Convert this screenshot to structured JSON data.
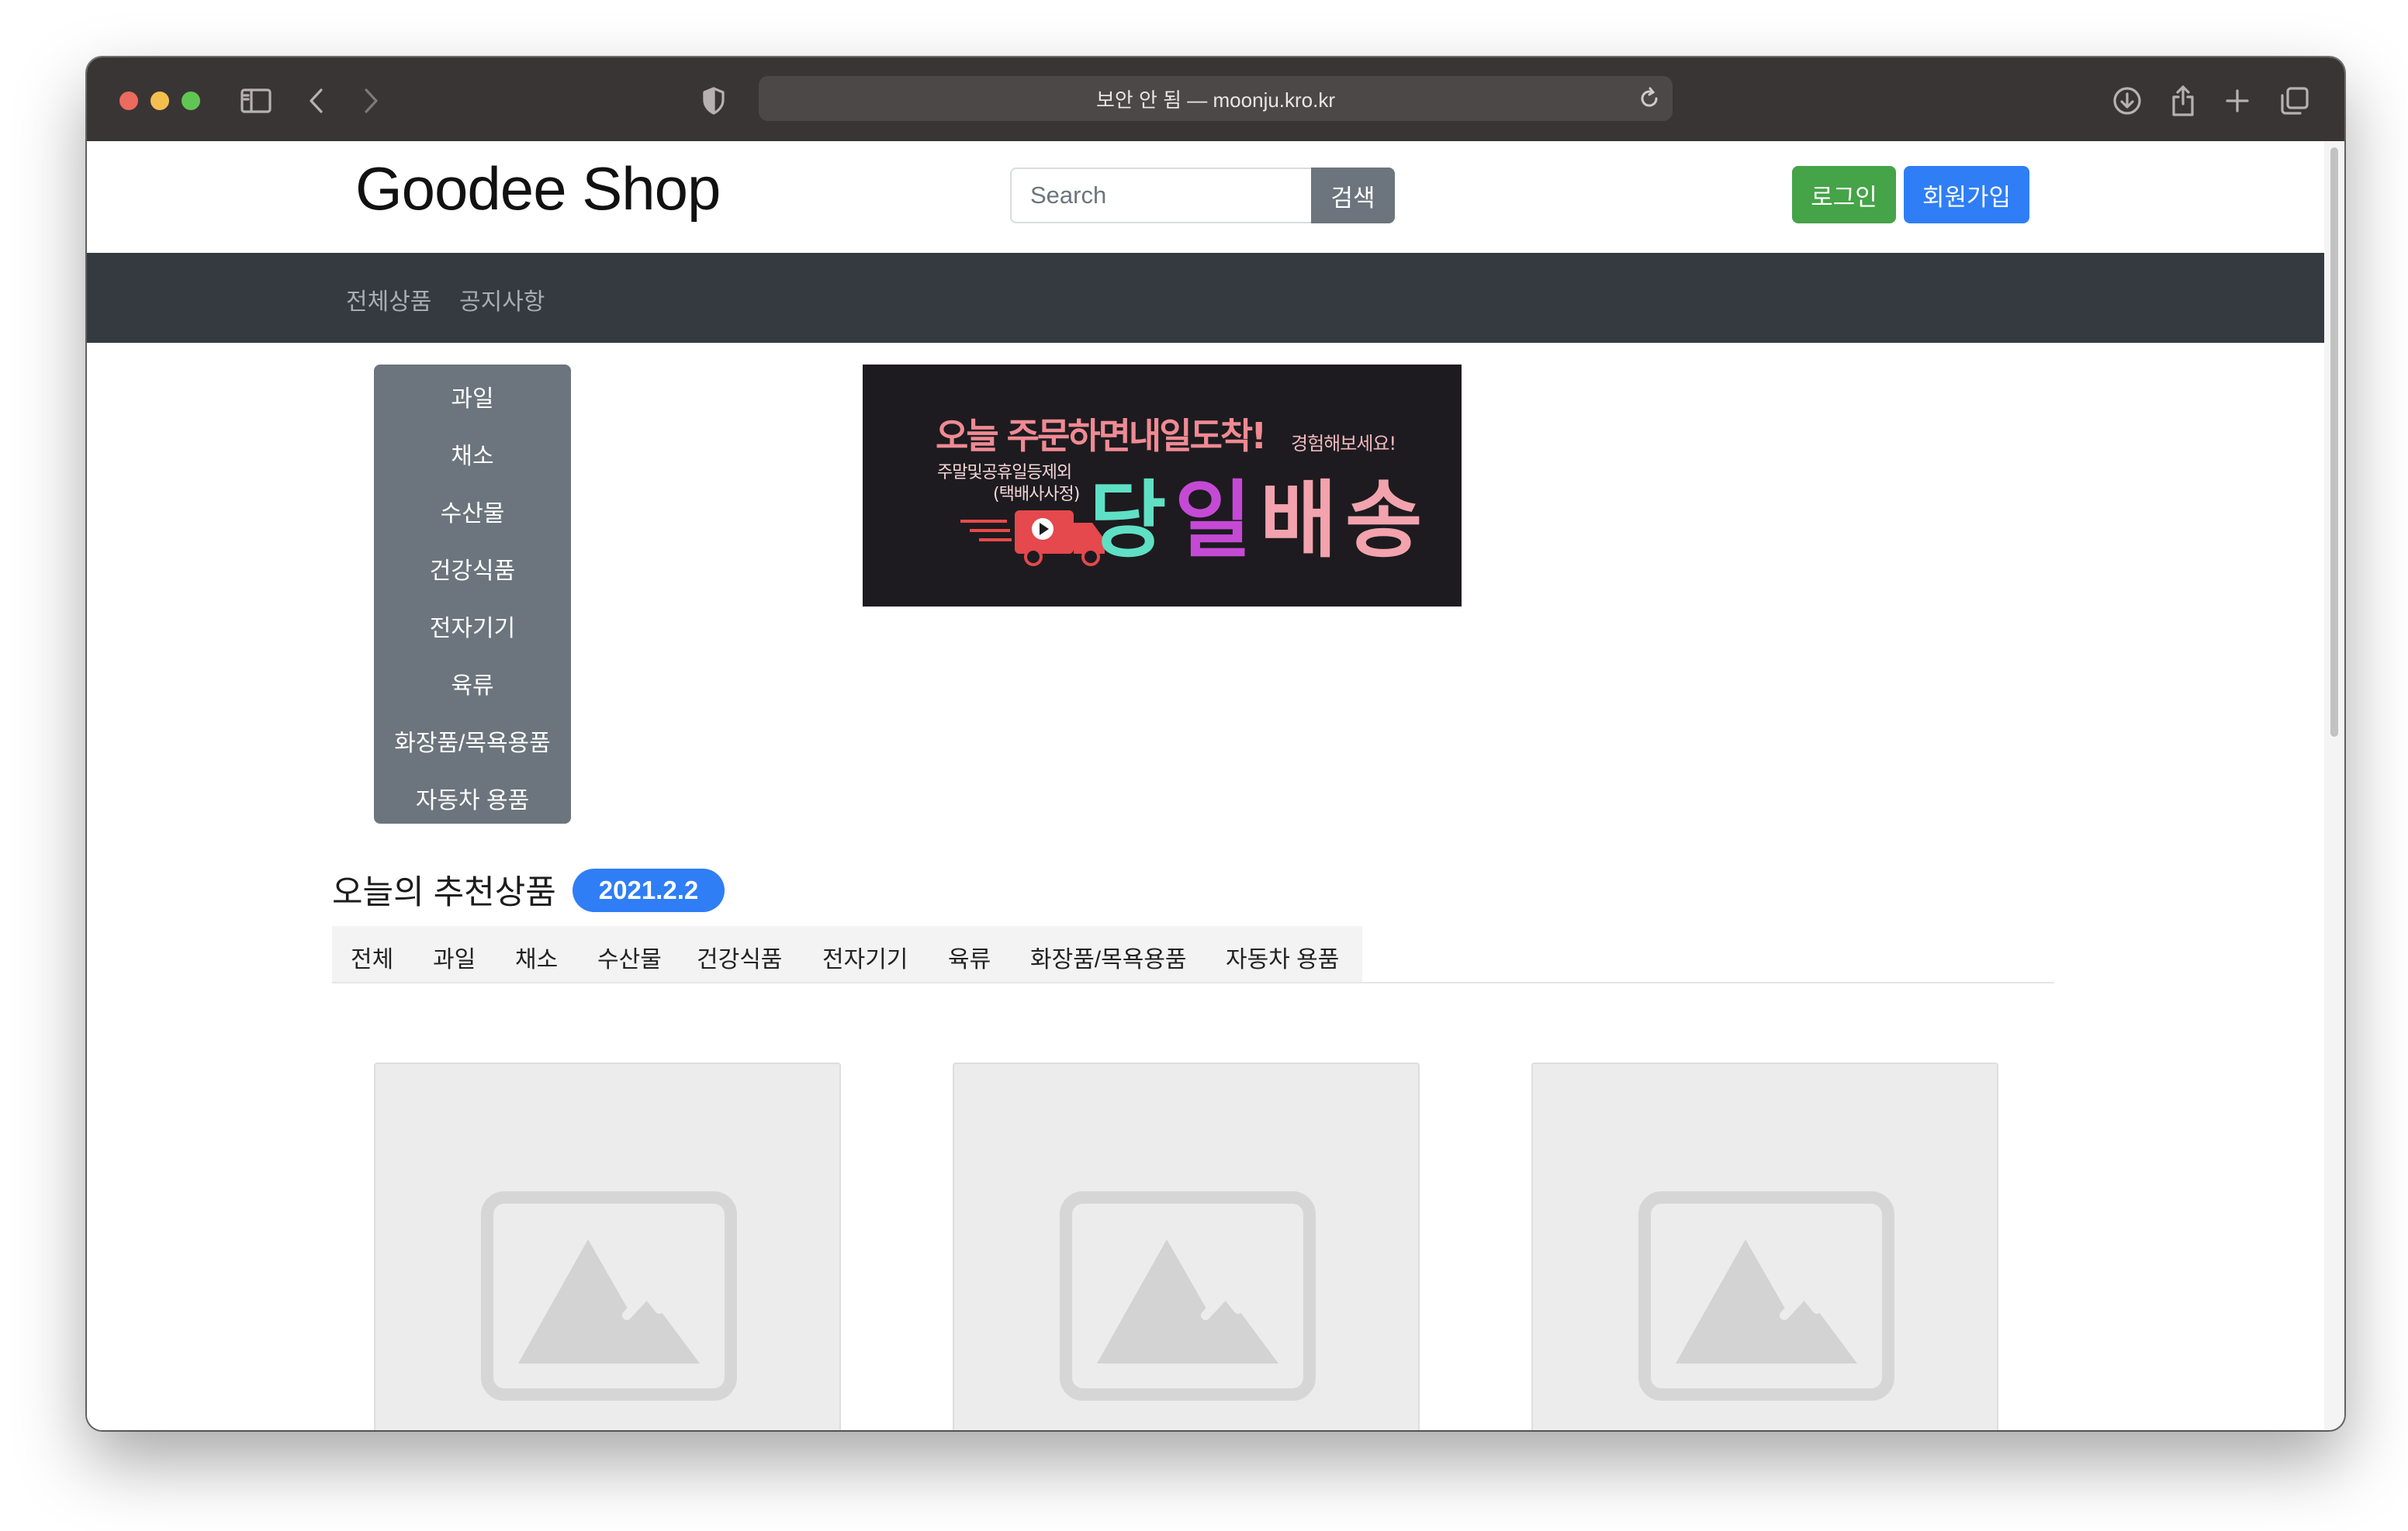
{
  "browser": {
    "address_text": "보안 안 됨 — moonju.kro.kr",
    "traffic_lights": [
      "#ed6a5e",
      "#f5bf4f",
      "#61c554"
    ]
  },
  "header": {
    "logo": "Goodee Shop",
    "search_placeholder": "Search",
    "search_button": "검색",
    "login_button": "로그인",
    "signup_button": "회원가입"
  },
  "nav": {
    "items": [
      "전체상품",
      "공지사항"
    ]
  },
  "categories": [
    "과일",
    "채소",
    "수산물",
    "건강식품",
    "전자기기",
    "육류",
    "화장품/목욕용품",
    "자동차 용품"
  ],
  "banner": {
    "line1": "오늘 주문하면내일도착!",
    "side_note": "경험해보세요!",
    "sub1": "주말및공휴일등제외",
    "sub2": "(택배사사정)",
    "main": "당일배송"
  },
  "recommend": {
    "title": "오늘의 추천상품",
    "date_badge": "2021.2.2",
    "tabs": [
      "전체",
      "과일",
      "채소",
      "수산물",
      "건강식품",
      "전자기기",
      "육류",
      "화장품/목욕용품",
      "자동차 용품"
    ]
  },
  "products": [
    {
      "image": "image-placeholder-icon"
    },
    {
      "image": "image-placeholder-icon"
    },
    {
      "image": "image-placeholder-icon"
    }
  ],
  "colors": {
    "nav_bg": "#343a40",
    "login": "#45a348",
    "primary": "#2f7ef6",
    "secondary": "#6c757d"
  }
}
